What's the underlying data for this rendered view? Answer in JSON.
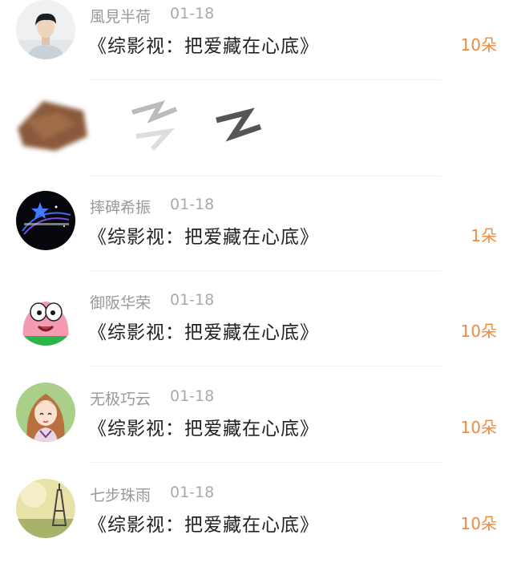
{
  "colors": {
    "username": "#999999",
    "date": "#aaaaaa",
    "title": "#222222",
    "count_accent": "#f08a3c",
    "divider": "#f1f1f1"
  },
  "items": [
    {
      "username": "風見半荷",
      "date": "01-18",
      "title": "《综影视：把爱藏在心底》",
      "count": "10朵",
      "avatar_icon": "person-avatar-icon"
    },
    {
      "username": "",
      "date": "",
      "title": "",
      "count": "",
      "avatar_icon": "redacted-avatar-icon"
    },
    {
      "username": "摔碑希振",
      "date": "01-18",
      "title": "《综影视：把爱藏在心底》",
      "count": "1朵",
      "avatar_icon": "starry-night-avatar-icon"
    },
    {
      "username": "御阪华荣",
      "date": "01-18",
      "title": "《综影视：把爱藏在心底》",
      "count": "10朵",
      "avatar_icon": "cartoon-starfish-avatar-icon"
    },
    {
      "username": "无极巧云",
      "date": "01-18",
      "title": "《综影视：把爱藏在心底》",
      "count": "10朵",
      "avatar_icon": "anime-girl-avatar-icon"
    },
    {
      "username": "七步珠雨",
      "date": "01-18",
      "title": "《综影视：把爱藏在心底》",
      "count": "10朵",
      "avatar_icon": "eiffel-tower-avatar-icon"
    }
  ]
}
